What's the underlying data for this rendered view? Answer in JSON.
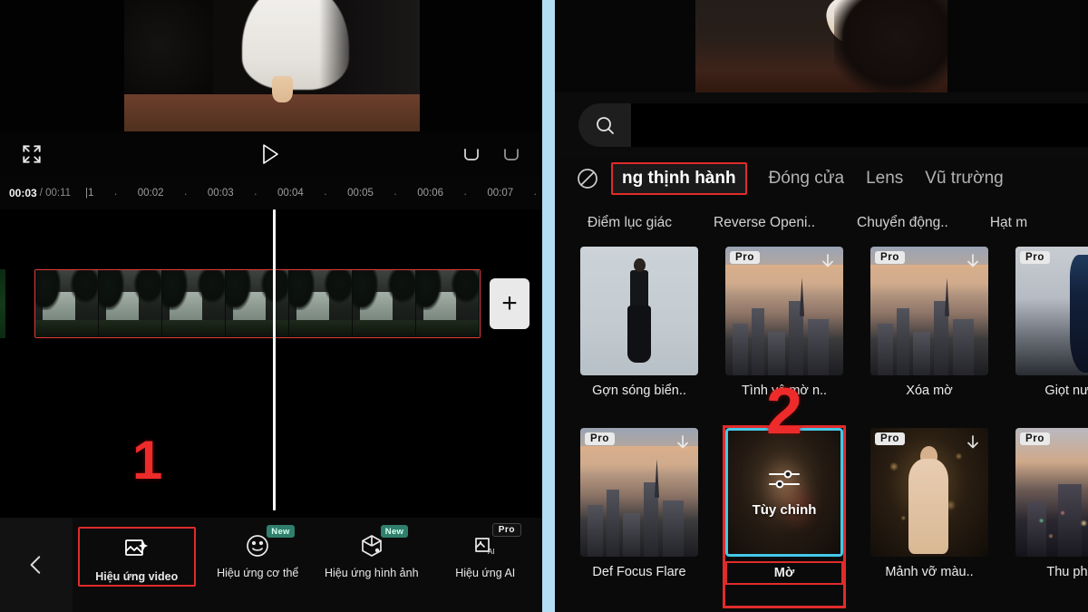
{
  "left_panel": {
    "player": {
      "fullscreen_icon": "expand-icon",
      "play_icon": "play-icon",
      "undo_icon": "undo-icon",
      "redo_icon": "redo-icon"
    },
    "timeline": {
      "current_time": "00:03",
      "total_time": "/ 00:11",
      "tick_labels": [
        "|1",
        "00:02",
        "00:03",
        "00:04",
        "00:05",
        "00:06",
        "00:07"
      ],
      "tick_dot": "·",
      "add_clip_label": "+",
      "playhead_position": "00:03"
    },
    "bottom_toolbar": {
      "back_icon": "chevron-left-icon",
      "items": [
        {
          "label": "Hiệu ứng video",
          "icon": "video-effect-icon",
          "badge": "",
          "selected": true
        },
        {
          "label": "Hiệu ứng cơ thể",
          "icon": "body-effect-icon",
          "badge": "New",
          "selected": false
        },
        {
          "label": "Hiệu ứng hình ảnh",
          "icon": "image-effect-icon",
          "badge": "New",
          "selected": false
        },
        {
          "label": "Hiệu ứng AI",
          "icon": "ai-effect-icon",
          "badge": "Pro",
          "selected": false
        }
      ]
    },
    "annotation": "1"
  },
  "right_panel": {
    "search": {
      "icon": "search-icon",
      "value": "",
      "placeholder": ""
    },
    "tabs": {
      "none_icon": "no-effect-icon",
      "items": [
        {
          "label": "ng thịnh hành",
          "active": true
        },
        {
          "label": "Đóng cửa",
          "active": false
        },
        {
          "label": "Lens",
          "active": false
        },
        {
          "label": "Vũ trường",
          "active": false
        }
      ]
    },
    "subtabs": [
      "Điểm lục giác",
      "Reverse Openi..",
      "Chuyển động..",
      "Hạt m"
    ],
    "effects_grid": {
      "rows": [
        [
          {
            "label": "Gợn sóng biển..",
            "badge": "",
            "download": false,
            "art": "model",
            "selected": false
          },
          {
            "label": "Tình yê  mờ n..",
            "badge": "Pro",
            "download": true,
            "art": "city",
            "selected": false
          },
          {
            "label": "Xóa mờ",
            "badge": "Pro",
            "download": true,
            "art": "city",
            "selected": false
          },
          {
            "label": "Giọt nước",
            "badge": "Pro",
            "download": false,
            "art": "darkperson",
            "selected": false
          }
        ],
        [
          {
            "label": "Def Focus Flare",
            "badge": "Pro",
            "download": true,
            "art": "city",
            "selected": false
          },
          {
            "label": "Mờ",
            "badge": "",
            "download": false,
            "art": "custom",
            "selected": true,
            "tile_label": "Tùy chỉnh",
            "tile_icon": "sliders-icon"
          },
          {
            "label": "Mảnh vỡ màu..",
            "badge": "Pro",
            "download": true,
            "art": "night",
            "selected": false
          },
          {
            "label": "Thu phón",
            "badge": "Pro",
            "download": false,
            "art": "citylights",
            "selected": false
          }
        ]
      ]
    },
    "annotation": "2"
  },
  "colors": {
    "accent_red": "#e02b2b",
    "accent_cyan": "#45c8e8",
    "divider_blue": "#b3ddf2",
    "badge_new": "#2f7f6c",
    "background": "#000000"
  }
}
